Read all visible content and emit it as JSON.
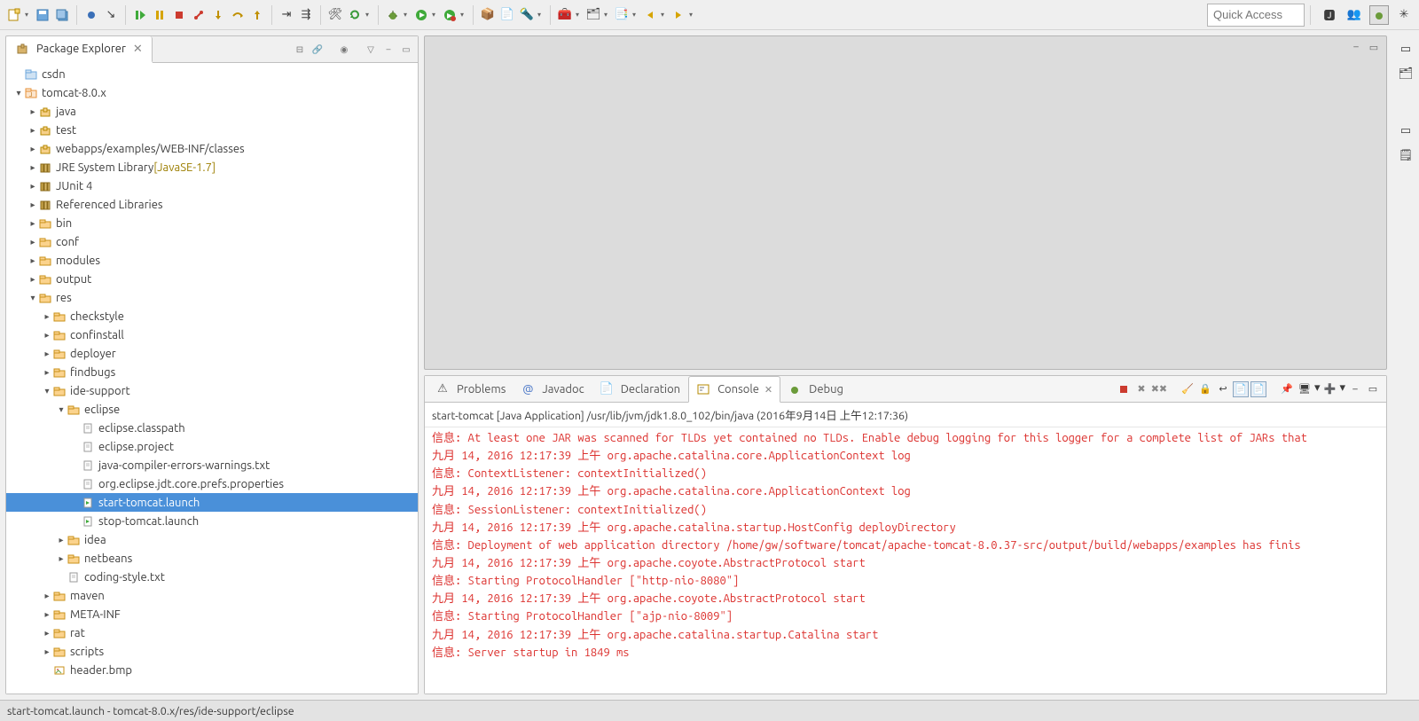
{
  "toolbar": {
    "quick_access_placeholder": "Quick Access"
  },
  "package_explorer": {
    "title": "Package Explorer",
    "tree": [
      {
        "d": 0,
        "tw": "",
        "ic": "proj-closed",
        "label": "csdn"
      },
      {
        "d": 0,
        "tw": "▾",
        "ic": "proj-java",
        "label": "tomcat-8.0.x"
      },
      {
        "d": 1,
        "tw": "▸",
        "ic": "pkgroot",
        "label": "java"
      },
      {
        "d": 1,
        "tw": "▸",
        "ic": "pkgroot",
        "label": "test"
      },
      {
        "d": 1,
        "tw": "▸",
        "ic": "pkgroot",
        "label": "webapps/examples/WEB-INF/classes"
      },
      {
        "d": 1,
        "tw": "▸",
        "ic": "lib",
        "label": "JRE System Library",
        "anno": " [JavaSE-1.7]"
      },
      {
        "d": 1,
        "tw": "▸",
        "ic": "lib",
        "label": "JUnit 4"
      },
      {
        "d": 1,
        "tw": "▸",
        "ic": "lib",
        "label": "Referenced Libraries"
      },
      {
        "d": 1,
        "tw": "▸",
        "ic": "folder",
        "label": "bin"
      },
      {
        "d": 1,
        "tw": "▸",
        "ic": "folder",
        "label": "conf"
      },
      {
        "d": 1,
        "tw": "▸",
        "ic": "folder",
        "label": "modules"
      },
      {
        "d": 1,
        "tw": "▸",
        "ic": "folder",
        "label": "output"
      },
      {
        "d": 1,
        "tw": "▾",
        "ic": "folder",
        "label": "res"
      },
      {
        "d": 2,
        "tw": "▸",
        "ic": "folder",
        "label": "checkstyle"
      },
      {
        "d": 2,
        "tw": "▸",
        "ic": "folder",
        "label": "confinstall"
      },
      {
        "d": 2,
        "tw": "▸",
        "ic": "folder",
        "label": "deployer"
      },
      {
        "d": 2,
        "tw": "▸",
        "ic": "folder",
        "label": "findbugs"
      },
      {
        "d": 2,
        "tw": "▾",
        "ic": "folder",
        "label": "ide-support"
      },
      {
        "d": 3,
        "tw": "▾",
        "ic": "folder",
        "label": "eclipse"
      },
      {
        "d": 4,
        "tw": "",
        "ic": "file",
        "label": "eclipse.classpath"
      },
      {
        "d": 4,
        "tw": "",
        "ic": "file",
        "label": "eclipse.project"
      },
      {
        "d": 4,
        "tw": "",
        "ic": "file",
        "label": "java-compiler-errors-warnings.txt"
      },
      {
        "d": 4,
        "tw": "",
        "ic": "file",
        "label": "org.eclipse.jdt.core.prefs.properties"
      },
      {
        "d": 4,
        "tw": "",
        "ic": "launch",
        "label": "start-tomcat.launch",
        "selected": true
      },
      {
        "d": 4,
        "tw": "",
        "ic": "launch",
        "label": "stop-tomcat.launch"
      },
      {
        "d": 3,
        "tw": "▸",
        "ic": "folder",
        "label": "idea"
      },
      {
        "d": 3,
        "tw": "▸",
        "ic": "folder",
        "label": "netbeans"
      },
      {
        "d": 3,
        "tw": "",
        "ic": "file",
        "label": "coding-style.txt"
      },
      {
        "d": 2,
        "tw": "▸",
        "ic": "folder",
        "label": "maven"
      },
      {
        "d": 2,
        "tw": "▸",
        "ic": "folder",
        "label": "META-INF"
      },
      {
        "d": 2,
        "tw": "▸",
        "ic": "folder",
        "label": "rat"
      },
      {
        "d": 2,
        "tw": "▸",
        "ic": "folder",
        "label": "scripts"
      },
      {
        "d": 2,
        "tw": "",
        "ic": "bmp",
        "label": "header.bmp"
      }
    ]
  },
  "bottom_tabs": {
    "problems": "Problems",
    "javadoc": "Javadoc",
    "declaration": "Declaration",
    "console": "Console",
    "debug": "Debug"
  },
  "console": {
    "description": "start-tomcat [Java Application] /usr/lib/jvm/jdk1.8.0_102/bin/java (2016年9月14日 上午12:17:36)",
    "lines": [
      "信息: At least one JAR was scanned for TLDs yet contained no TLDs. Enable debug logging for this logger for a complete list of JARs that",
      "九月 14, 2016 12:17:39 上午 org.apache.catalina.core.ApplicationContext log",
      "信息: ContextListener: contextInitialized()",
      "九月 14, 2016 12:17:39 上午 org.apache.catalina.core.ApplicationContext log",
      "信息: SessionListener: contextInitialized()",
      "九月 14, 2016 12:17:39 上午 org.apache.catalina.startup.HostConfig deployDirectory",
      "信息: Deployment of web application directory /home/gw/software/tomcat/apache-tomcat-8.0.37-src/output/build/webapps/examples has finis",
      "九月 14, 2016 12:17:39 上午 org.apache.coyote.AbstractProtocol start",
      "信息: Starting ProtocolHandler [\"http-nio-8080\"]",
      "九月 14, 2016 12:17:39 上午 org.apache.coyote.AbstractProtocol start",
      "信息: Starting ProtocolHandler [\"ajp-nio-8009\"]",
      "九月 14, 2016 12:17:39 上午 org.apache.catalina.startup.Catalina start",
      "信息: Server startup in 1849 ms"
    ]
  },
  "status_bar": "start-tomcat.launch - tomcat-8.0.x/res/ide-support/eclipse"
}
